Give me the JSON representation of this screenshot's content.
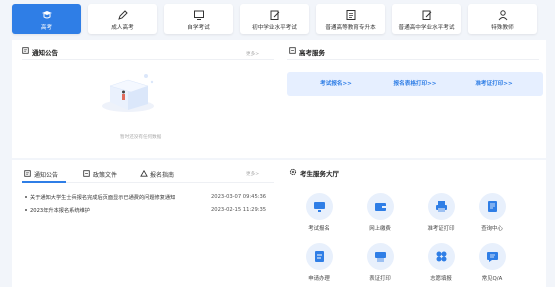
{
  "nav": {
    "tabs": [
      {
        "label": "高考",
        "icon": "graduation-cap-icon",
        "active": true
      },
      {
        "label": "成人高考",
        "icon": "pen-icon"
      },
      {
        "label": "自学考试",
        "icon": "screen-icon"
      },
      {
        "label": "初中学业水平考试",
        "icon": "edit-icon"
      },
      {
        "label": "普通高等教育专升本",
        "icon": "document-icon"
      },
      {
        "label": "普通高中学业水平考试",
        "icon": "edit-icon"
      },
      {
        "label": "特殊教师",
        "icon": "person-icon"
      }
    ]
  },
  "notice_top": {
    "title": "通知公告",
    "more": "更多>",
    "empty_text": "暂时还没有任何数据"
  },
  "gaokao_service": {
    "title": "高考服务",
    "buttons": [
      "考试报名>>",
      "报名表格打印>>",
      "准考证打印>>"
    ]
  },
  "notice_tabs": {
    "tabs": [
      "通知公告",
      "政策文件",
      "报名指南"
    ],
    "more": "更多>",
    "rows": [
      {
        "title": "关于通知大学生士兵报名完成后页面显示已通费的问题修复通知",
        "date": "2023-03-07 09:45:36"
      },
      {
        "title": "2023年升本报名系统维护",
        "date": "2023-02-15 11:29:35"
      }
    ]
  },
  "hall": {
    "title": "考生服务大厅",
    "items": [
      {
        "label": "考试报名",
        "icon": "monitor-icon"
      },
      {
        "label": "网上缴费",
        "icon": "wallet-icon"
      },
      {
        "label": "准考证打印",
        "icon": "printer-icon"
      },
      {
        "label": "查询中心",
        "icon": "document-search-icon"
      },
      {
        "label": "申请办理",
        "icon": "form-icon"
      },
      {
        "label": "表证打印",
        "icon": "print-card-icon"
      },
      {
        "label": "志愿填报",
        "icon": "grid-icon"
      },
      {
        "label": "常见Q/A",
        "icon": "qa-icon"
      }
    ]
  },
  "colors": {
    "accent": "#2f7ee6",
    "light_accent": "#e6efff",
    "bg": "#f2f5fa"
  }
}
